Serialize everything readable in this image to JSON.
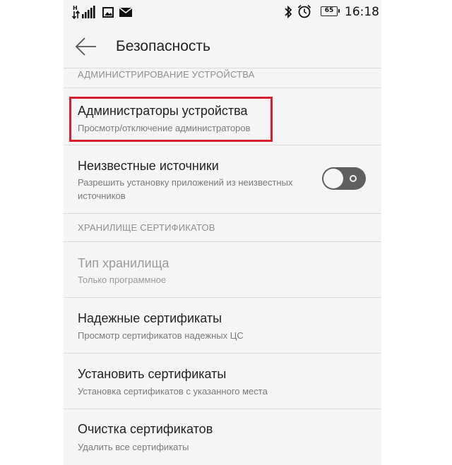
{
  "status_bar": {
    "network": "H",
    "battery": "65",
    "time": "16:18"
  },
  "header": {
    "title": "Безопасность"
  },
  "sections": {
    "admin": {
      "header": "АДМИНИСТРИРОВАНИЕ УСТРОЙСТВА",
      "device_admins": {
        "title": "Администраторы устройства",
        "subtitle": "Просмотр/отключение администраторов"
      },
      "unknown_sources": {
        "title": "Неизвестные источники",
        "subtitle_line1": "Разрешить установку приложений из неизвестных",
        "subtitle_line2": "источников",
        "enabled": false
      }
    },
    "cert_storage": {
      "header": "ХРАНИЛИЩЕ СЕРТИФИКАТОВ",
      "storage_type": {
        "title": "Тип хранилища",
        "subtitle": "Только программное"
      },
      "trusted_certs": {
        "title": "Надежные сертификаты",
        "subtitle": "Просмотр сертификатов надежных ЦС"
      },
      "install_certs": {
        "title": "Установить сертификаты",
        "subtitle": "Установка сертификатов с указанного места"
      },
      "clear_certs": {
        "title": "Очистка сертификатов",
        "subtitle": "Удалить все сертификаты"
      }
    }
  },
  "colors": {
    "highlight": "#d6202e",
    "toggle_off": "#5f5f5f"
  }
}
